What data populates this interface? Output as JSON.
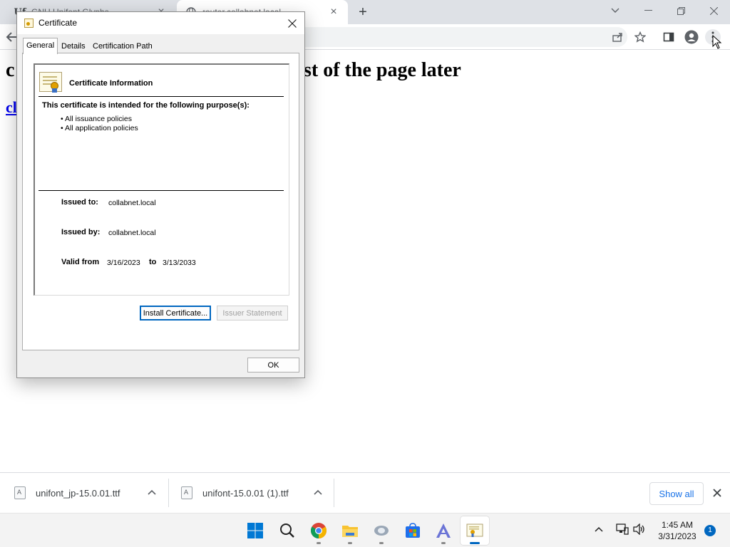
{
  "browser": {
    "tabs": [
      {
        "title": "GNU Unifont Glyphs",
        "favicon": "Uf"
      },
      {
        "title": "router.collabnet.local"
      }
    ]
  },
  "page": {
    "heading_start": "c",
    "heading_end": "st of the page later",
    "link_text": "cl"
  },
  "dialog": {
    "title": "Certificate",
    "tabs": [
      "General",
      "Details",
      "Certification Path"
    ],
    "info_title": "Certificate Information",
    "purpose_heading": "This certificate is intended for the following purpose(s):",
    "policies": [
      "• All issuance policies",
      "• All application policies"
    ],
    "issued_to_label": "Issued to:",
    "issued_to": "collabnet.local",
    "issued_by_label": "Issued by:",
    "issued_by": "collabnet.local",
    "valid_from_label": "Valid from",
    "valid_from": "3/16/2023",
    "to_label": "to",
    "valid_to": "3/13/2033",
    "install_button": "Install Certificate...",
    "issuer_button": "Issuer Statement",
    "ok_button": "OK"
  },
  "downloads": {
    "items": [
      "unifont_jp-15.0.01.ttf",
      "unifont-15.0.01 (1).ttf"
    ],
    "show_all": "Show all"
  },
  "taskbar": {
    "time": "1:45 AM",
    "date": "3/31/2023",
    "notifications": "1",
    "apps": [
      "start-icon",
      "search-icon",
      "chrome-icon",
      "file-explorer-icon",
      "app-icon",
      "store-icon",
      "font-app-icon",
      "certificate-app-icon"
    ]
  }
}
